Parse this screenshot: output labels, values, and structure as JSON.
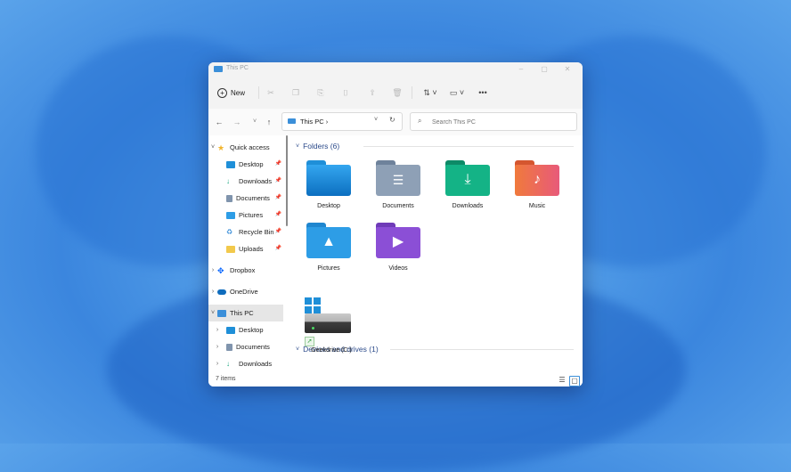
{
  "window": {
    "title": "This PC"
  },
  "toolbar": {
    "new_label": "New"
  },
  "address": {
    "crumb": "This PC  ›"
  },
  "search": {
    "placeholder": "Search This PC"
  },
  "nav": {
    "quick_access": "Quick access",
    "qa_items": [
      "Desktop",
      "Downloads",
      "Documents",
      "Pictures",
      "Recycle Bin",
      "Uploads"
    ],
    "dropbox": "Dropbox",
    "onedrive": "OneDrive",
    "this_pc": "This PC",
    "pc_items": [
      "Desktop",
      "Documents",
      "Downloads"
    ]
  },
  "folders_header": "Folders (6)",
  "folders": [
    {
      "label": "Desktop",
      "icon": "desktop-folder-icon",
      "color": "#1f8fd8"
    },
    {
      "label": "Documents",
      "icon": "documents-folder-icon",
      "color": "#8094ad"
    },
    {
      "label": "Downloads",
      "icon": "downloads-folder-icon",
      "color": "#10a37a"
    },
    {
      "label": "Music",
      "icon": "music-folder-icon",
      "color": "#e9653f"
    },
    {
      "label": "Pictures",
      "icon": "pictures-folder-icon",
      "color": "#2d9de6"
    },
    {
      "label": "Videos",
      "icon": "videos-folder-icon",
      "color": "#8b4fd6"
    }
  ],
  "devices_header": "Devices and drives (1)",
  "drive": {
    "label": "Geekdrive (C:)"
  },
  "status": {
    "count": "7 items"
  },
  "colors": {
    "accent": "#3b8fd9",
    "header_text": "#2b4a8a",
    "selected_bg": "#e6e6e6"
  }
}
